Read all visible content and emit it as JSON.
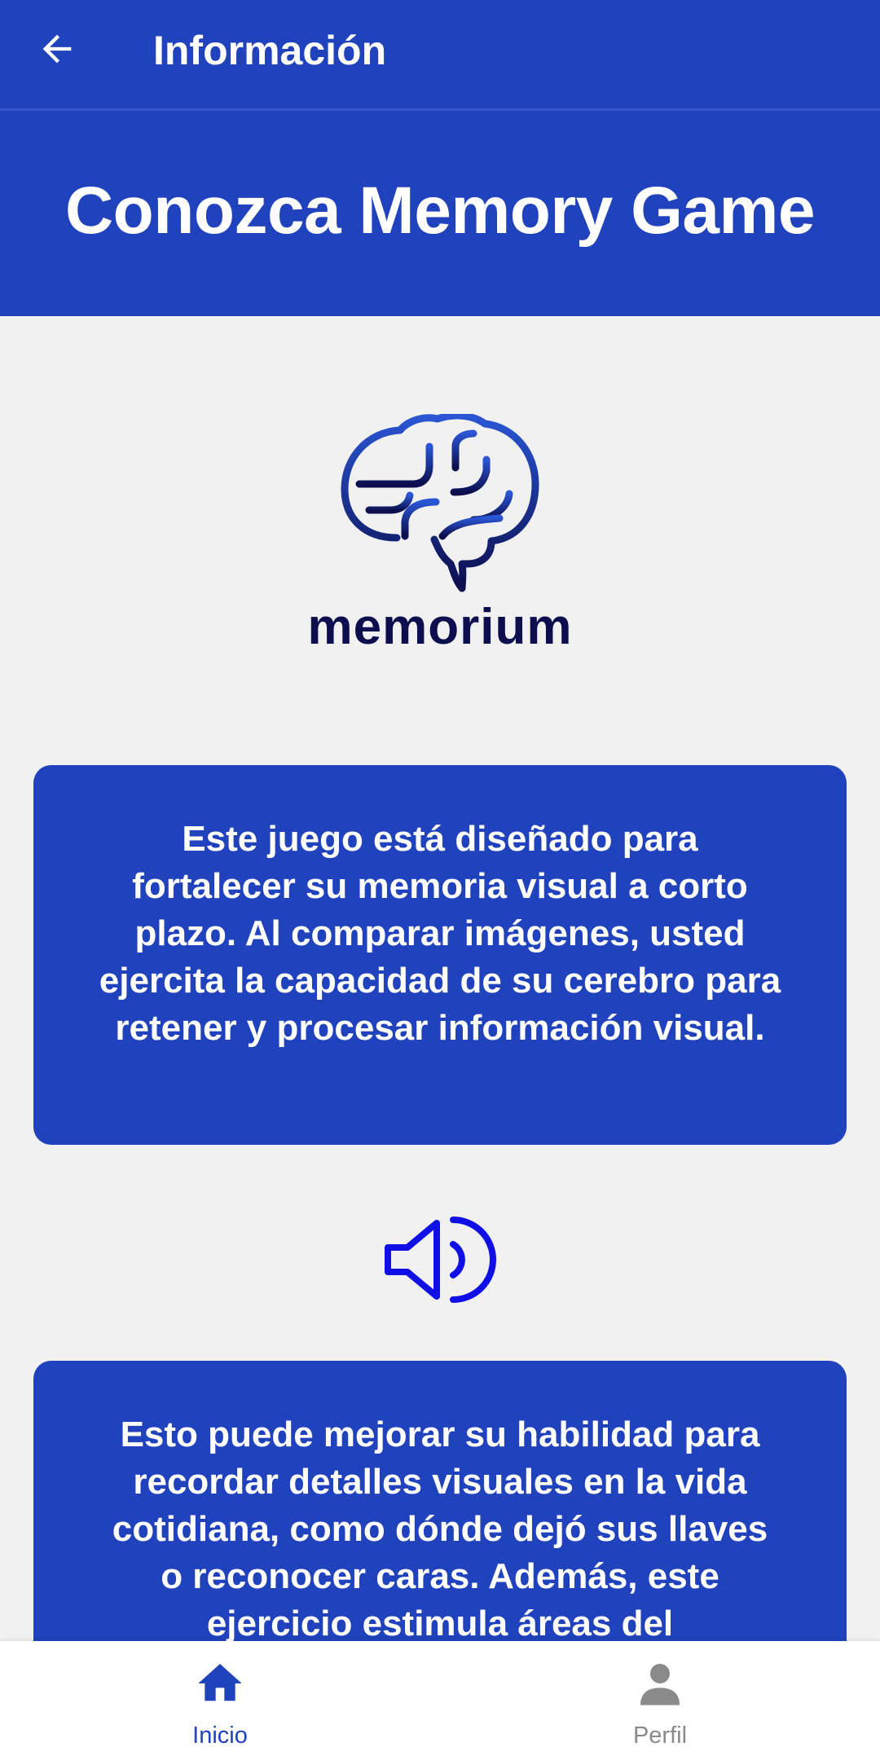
{
  "app_bar": {
    "title": "Información",
    "back_icon": "arrow-left-icon"
  },
  "hero": {
    "title": "Conozca Memory Game"
  },
  "logo": {
    "wordmark": "memorium",
    "icon": "brain-icon"
  },
  "cards": [
    {
      "text": "Este juego está diseñado para fortalecer su memoria visual a corto plazo. Al comparar imágenes, usted ejercita la capacidad de su cerebro para retener y procesar información visual."
    },
    {
      "text": "Esto puede mejorar su habilidad para recordar detalles visuales en la vida cotidiana, como dónde dejó sus llaves o reconocer caras. Además, este ejercicio estimula áreas del"
    }
  ],
  "speaker": {
    "icon": "volume-icon"
  },
  "bottom_nav": {
    "items": [
      {
        "label": "Inicio",
        "icon": "home-icon",
        "active": true
      },
      {
        "label": "Perfil",
        "icon": "person-icon",
        "active": false
      }
    ]
  },
  "colors": {
    "primary": "#2142bd",
    "background": "#f1f1f1",
    "logo_dark": "#0c0e4d",
    "speaker": "#1010e6",
    "inactive": "#8a8a8a"
  }
}
